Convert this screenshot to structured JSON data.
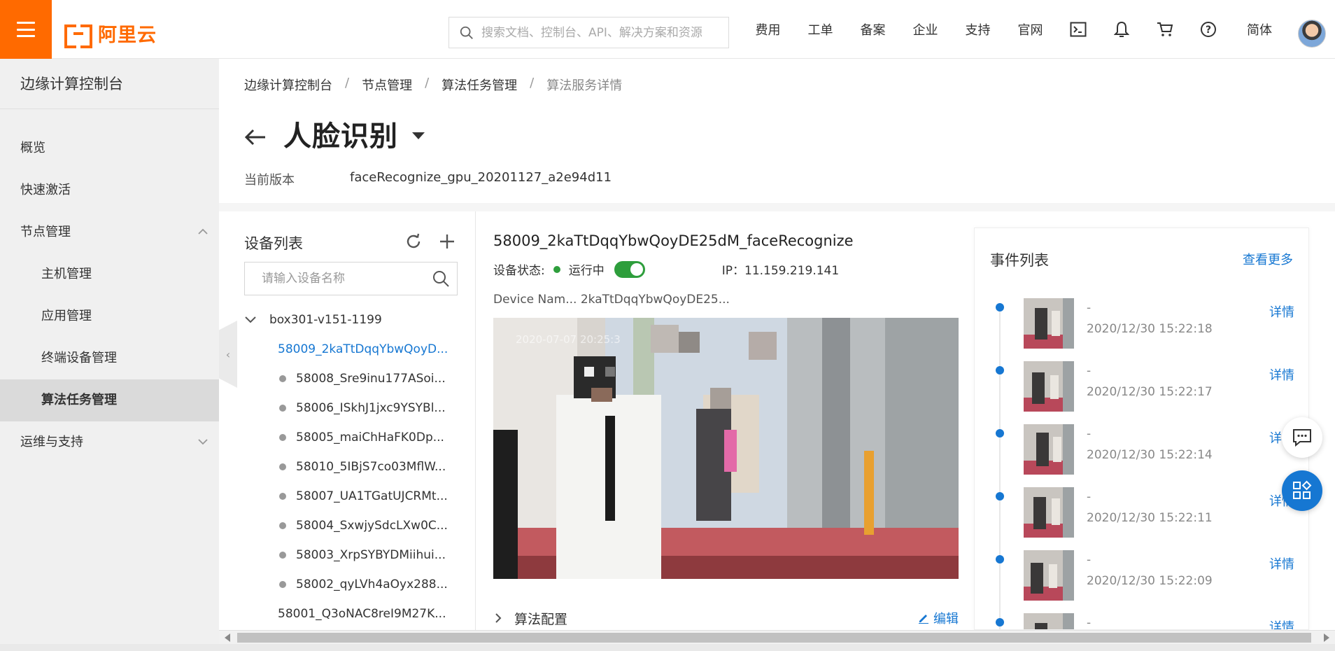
{
  "topbar": {
    "brand": "阿里云",
    "search_placeholder": "搜索文档、控制台、API、解决方案和资源",
    "nav": [
      "费用",
      "工单",
      "备案",
      "企业",
      "支持",
      "官网"
    ],
    "lang": "简体",
    "icons": [
      "terminal-icon",
      "bell-icon",
      "cart-icon",
      "help-icon"
    ]
  },
  "sidebar": {
    "title": "边缘计算控制台",
    "items": [
      {
        "label": "概览"
      },
      {
        "label": "快速激活"
      },
      {
        "label": "节点管理"
      },
      {
        "label": "主机管理"
      },
      {
        "label": "应用管理"
      },
      {
        "label": "终端设备管理"
      },
      {
        "label": "算法任务管理"
      },
      {
        "label": "运维与支持"
      }
    ]
  },
  "breadcrumb": [
    "边缘计算控制台",
    "节点管理",
    "算法任务管理",
    "算法服务详情"
  ],
  "page": {
    "title": "人脸识别",
    "version_label": "当前版本",
    "version_value": "faceRecognize_gpu_20201127_a2e94d11"
  },
  "devices": {
    "title": "设备列表",
    "search_placeholder": "请输入设备名称",
    "root": "box301-v151-1199",
    "items": [
      "58009_2kaTtDqqYbwQoyD...",
      "58008_Sre9inu177ASoi...",
      "58006_ISkhJ1jxc9YSYBl...",
      "58005_maiChHaFK0Dp...",
      "58010_5IBjS7co03MflW...",
      "58007_UA1TGatUJCRMt...",
      "58004_SxwjySdcLXw0C...",
      "58003_XrpSYBYDMiihui...",
      "58002_qyLVh4aOyx288...",
      "58001_Q3oNAC8reI9M27K..."
    ]
  },
  "detail": {
    "device_full_name": "58009_2kaTtDqqYbwQoyDE25dM_faceRecognize",
    "status_label": "设备状态:",
    "status_value": "运行中",
    "ip": "IP：11.159.219.141",
    "device_name_row": "Device Nam...  2kaTtDqqYbwQoyDE25...",
    "video_timestamp": "2020-07-07 20:25:3",
    "algo_config": "算法配置",
    "edit": "编辑"
  },
  "events": {
    "title": "事件列表",
    "more": "查看更多",
    "detail_label": "详情",
    "items": [
      {
        "text": "-",
        "time": "2020/12/30 15:22:18"
      },
      {
        "text": "-",
        "time": "2020/12/30 15:22:17"
      },
      {
        "text": "-",
        "time": "2020/12/30 15:22:14"
      },
      {
        "text": "-",
        "time": "2020/12/30 15:22:11"
      },
      {
        "text": "-",
        "time": "2020/12/30 15:22:09"
      },
      {
        "text": "-",
        "time": ""
      }
    ]
  },
  "colors": {
    "accent": "#ff6a00",
    "link": "#1677d2",
    "running": "#2e9e3c"
  }
}
